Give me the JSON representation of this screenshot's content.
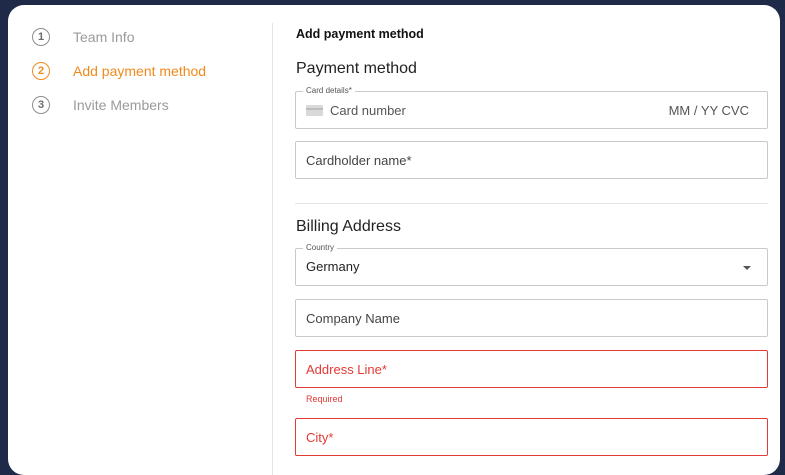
{
  "steps": [
    {
      "number": "1",
      "label": "Team Info"
    },
    {
      "number": "2",
      "label": "Add payment method"
    },
    {
      "number": "3",
      "label": "Invite Members"
    }
  ],
  "main": {
    "heading": "Add payment method",
    "payment_title": "Payment method",
    "card_field": {
      "legend": "Card details*",
      "placeholder": "Card number",
      "expiry_cvc": "MM / YY  CVC",
      "icon": "credit-card-icon"
    },
    "cardholder_field": {
      "placeholder": "Cardholder name*"
    },
    "billing_title": "Billing Address",
    "country_field": {
      "legend": "Country",
      "value": "Germany",
      "icon": "chevron-down-icon"
    },
    "company_field": {
      "placeholder": "Company Name"
    },
    "address_field": {
      "placeholder": "Address Line*",
      "error": "Required"
    },
    "city_field": {
      "placeholder": "City*"
    }
  },
  "colors": {
    "accent": "#f08a1c",
    "error": "#e53935",
    "background": "#1f2a48"
  }
}
